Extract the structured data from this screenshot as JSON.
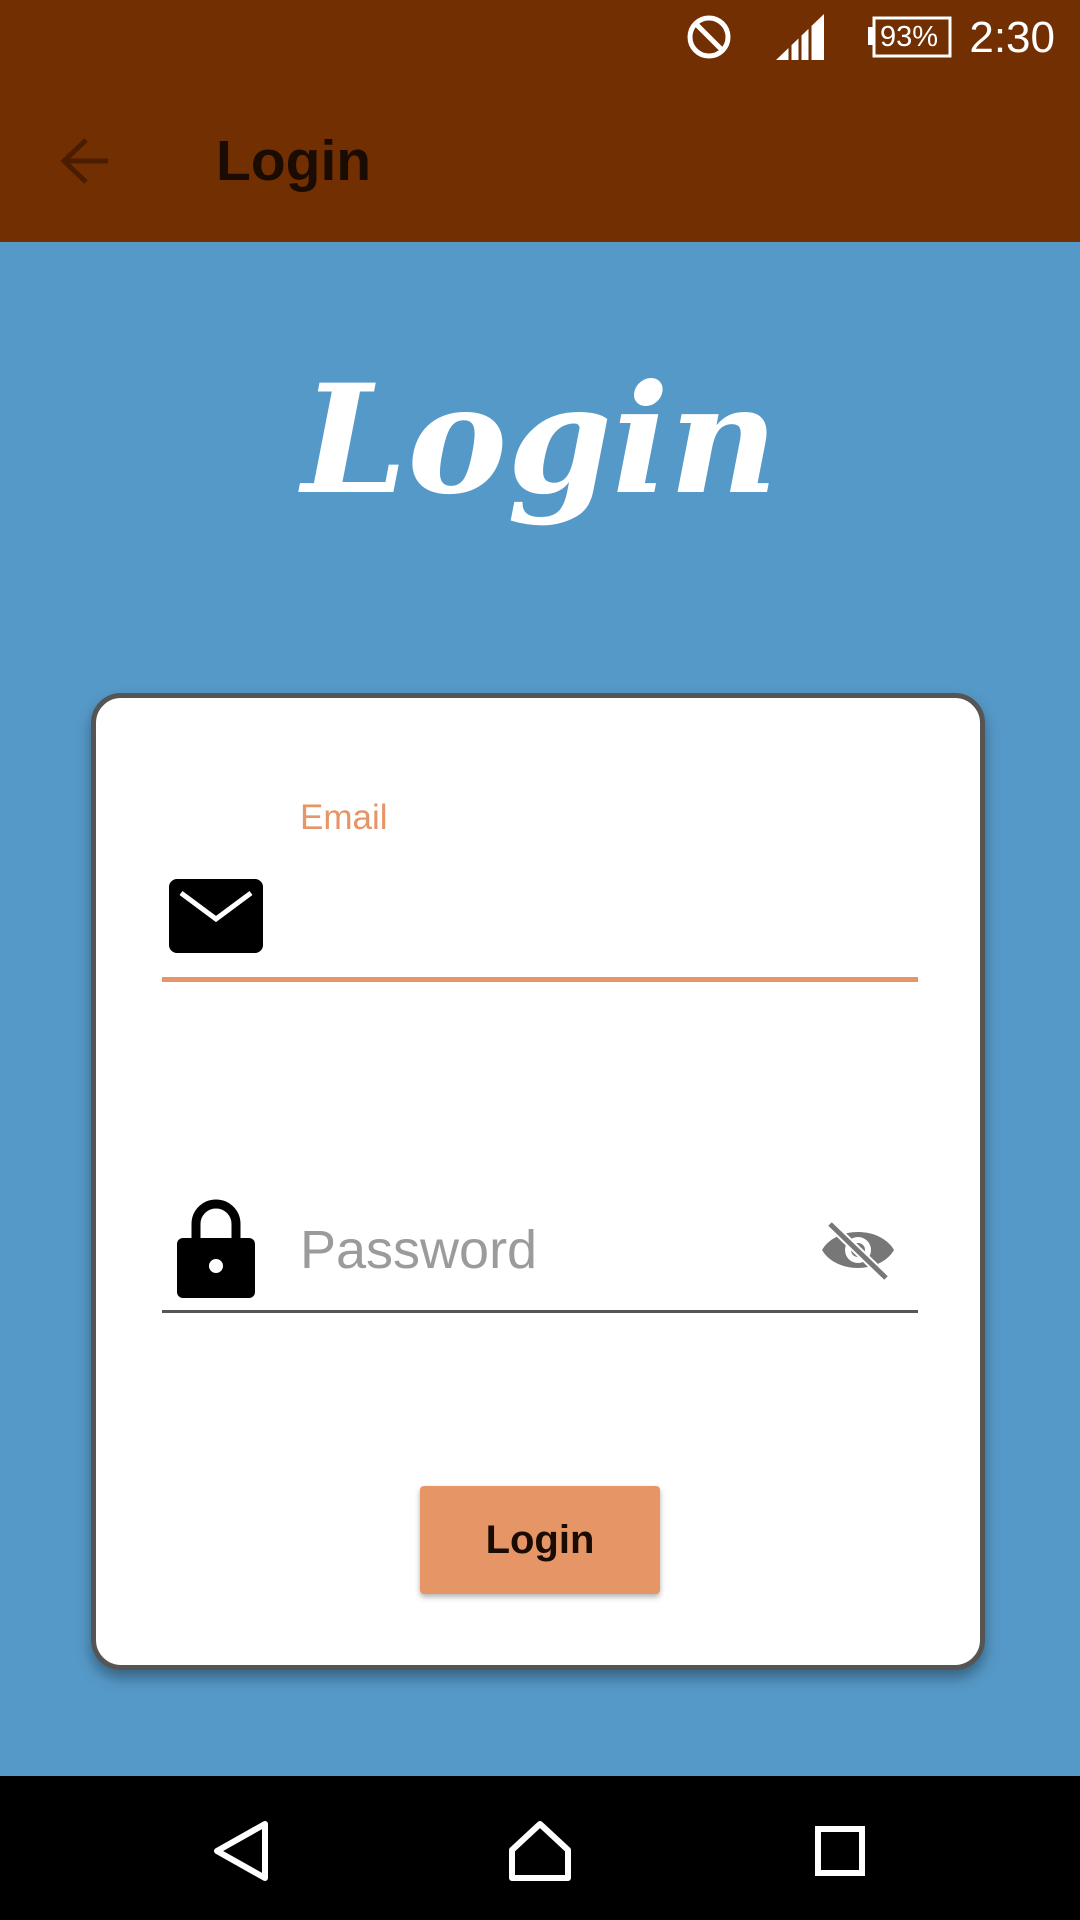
{
  "status_bar": {
    "time": "2:30",
    "battery_percent": "93%",
    "icons": [
      "do-not-disturb-icon",
      "signal-icon",
      "battery-icon"
    ]
  },
  "app_bar": {
    "title": "Login",
    "back_icon": "arrow-back-icon"
  },
  "hero": {
    "title": "Login"
  },
  "form": {
    "email": {
      "label": "Email",
      "value": "",
      "icon": "mail-icon"
    },
    "password": {
      "placeholder": "Password",
      "value": "",
      "icon": "lock-icon",
      "toggle_icon": "visibility-off-icon"
    },
    "submit_label": "Login"
  },
  "nav_bar": {
    "icons": [
      "back-triangle-icon",
      "home-icon",
      "recents-icon"
    ]
  },
  "colors": {
    "status_bar": "#722f01",
    "background": "#5599c8",
    "accent": "#e59566",
    "card": "#ffffff"
  }
}
